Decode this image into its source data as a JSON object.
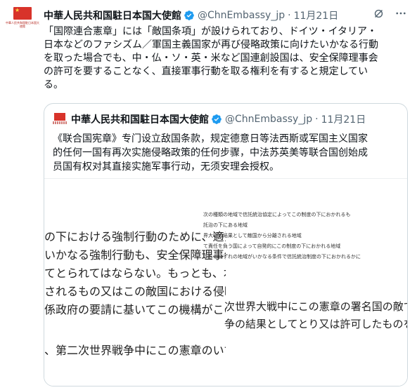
{
  "tweet": {
    "author": "中華人民共和国駐日本国大使館",
    "handle": "@ChnEmbassy_jp",
    "separator": "·",
    "date": "11月21日",
    "avatar_caption": "中華人民共和国駐日本国大使館",
    "text_lines": [
      "「国際連合憲章」には「敵国条項」が設けられており、ドイツ・イタリア・",
      "日本などのファシズム／軍国主義国家が再び侵略政策に向けたいかなる行動",
      "を取った場合でも、中・仏・ソ・英・米など国連創設国は、安全保障理事会",
      "の許可を要することなく、直接軍事行動を取る権利を有すると規定してい",
      "る。"
    ],
    "icons": [
      "verified-badge-icon",
      "grok-icon",
      "more-icon"
    ]
  },
  "quote": {
    "author": "中華人民共和国駐日本国大使館",
    "handle": "@ChnEmbassy_jp",
    "separator": "·",
    "date": "11月21日",
    "text_lines": [
      "《联合国宪章》专门设立敌国条款，规定德意日等法西斯或军国主义国家",
      "的任何一国有再次实施侵略政策的任何步骤，中法苏英美等联合国创始成",
      "员国有权对其直接实施军事行动，无须安理会授权。"
    ]
  },
  "media": {
    "left_lines": [
      "の下における強制行動のために、適当な",
      "いかなる強制行動も、安全保障理事会",
      "てとられてはならない。もっとも、本条",
      "されるもの又はこの敵国における侵略",
      "係政府の要請に基いてこの機構がこの敵"
    ],
    "left_bottom_lines": [
      "、第二次世界戦争中にこの憲章のいず"
    ],
    "right_top_lines": [
      "次の種類の地域で信託統治協定によってこの制度の下におかれるも",
      "託治の下にある地域",
      "界大戦の結果として敵国から分離される地域",
      "て責任を負う国によって自発的にこの制度の下におかれる地域",
      "うちのいずれの地域がいかなる条件で信託統治制度の下におかれるかに"
    ],
    "right_bottom_lines": [
      "次世界大戦中にこの憲章の署名国の敵であ",
      "争の結果としてとり又は許可したものを無"
    ]
  },
  "colors": {
    "verified": "#1d9bf0",
    "flag": "#d8332a",
    "muted": "#536471",
    "border": "#cfd9de"
  }
}
